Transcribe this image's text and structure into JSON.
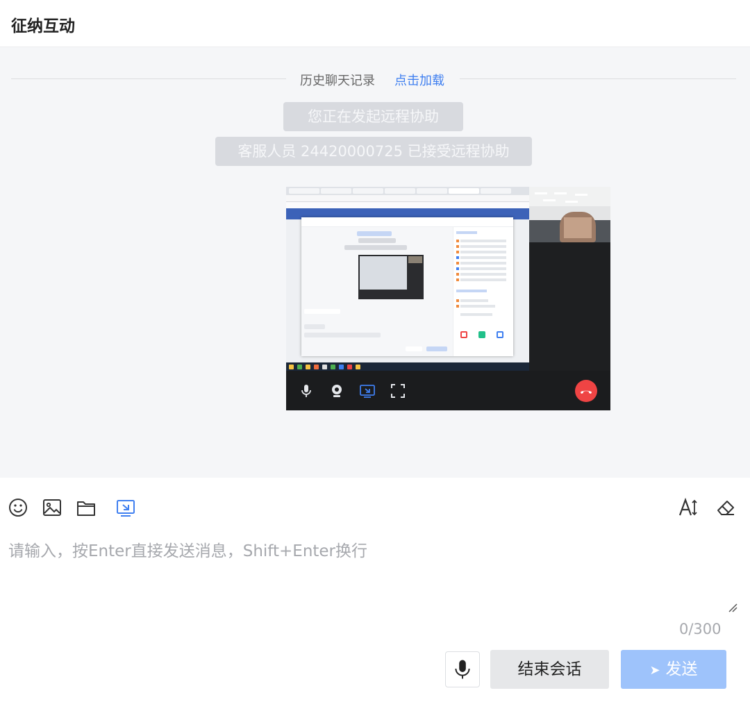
{
  "header": {
    "title": "征纳互动"
  },
  "chat": {
    "history_label": "历史聊天记录",
    "history_link": "点击加载",
    "messages": [
      {
        "text": "您正在发起远程协助"
      },
      {
        "text": "客服人员 24420000725 已接受远程协助"
      }
    ]
  },
  "toolbar": {
    "left_icons": [
      "emoji-icon",
      "image-icon",
      "folder-icon",
      "remote-assist-icon"
    ],
    "right_icons": [
      "font-size-icon",
      "eraser-icon"
    ],
    "accent_color": "#3f7ff0"
  },
  "input": {
    "placeholder": "请输入，按Enter直接发送消息，Shift+Enter换行",
    "value": "",
    "counter": "0/300"
  },
  "actions": {
    "end_label": "结束会话",
    "send_label": "发送",
    "send_color": "#9ec3fb",
    "hangup_color": "#ef4444"
  }
}
